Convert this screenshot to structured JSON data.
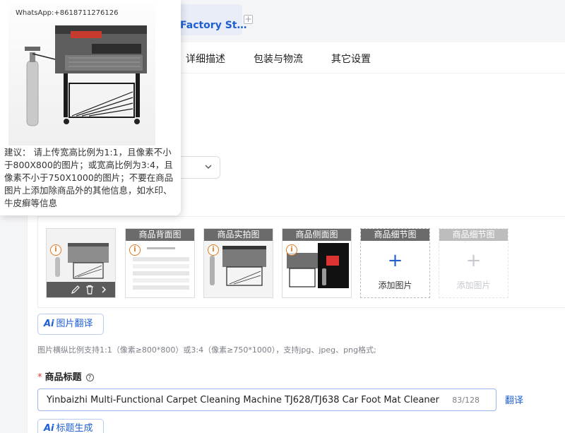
{
  "header": {
    "store_tab_label": "Factory St…",
    "add_tab_symbol": "+"
  },
  "section_tabs": [
    {
      "label": "详细描述"
    },
    {
      "label": "包装与物流"
    },
    {
      "label": "其它设置"
    }
  ],
  "popover": {
    "watermark": "WhatsApp:+8618711276126",
    "advice_text": "建议： 请上传宽高比例为1:1，且像素不小于800X800的图片；或宽高比例为3:4，且像素不小于750X1000的图片；不要在商品图片上添加除商品外的其他信息，如水印、牛皮癣等信息"
  },
  "image_slots": [
    {
      "label": "",
      "type": "main"
    },
    {
      "label": "商品背面图",
      "type": "filled"
    },
    {
      "label": "商品实拍图",
      "type": "filled"
    },
    {
      "label": "商品侧面图",
      "type": "filled"
    },
    {
      "label": "商品细节图",
      "type": "empty",
      "add_text": "添加图片"
    },
    {
      "label": "商品细节图",
      "type": "disabled",
      "add_text": "添加图片"
    }
  ],
  "image_translate_button": {
    "ai": "Ai",
    "label": "图片翻译"
  },
  "image_hint": "图片横纵比例支持1:1（像素≥800*800）或3:4（像素≥750*1000），支持jpg、jpeg、png格式;",
  "title_field": {
    "required_mark": "*",
    "label": "商品标题",
    "help": "?",
    "value": "Yinbaizhi Multi-Functional Carpet Cleaning Machine TJ628/TJ638 Car Foot Mat Cleaner",
    "count": "83/128",
    "translate_label": "翻译"
  },
  "title_generate_button": {
    "ai": "Ai",
    "label": "标题生成"
  },
  "colors": {
    "accent": "#1f5fd1",
    "warning": "#e07a1f",
    "required": "#e53935"
  }
}
